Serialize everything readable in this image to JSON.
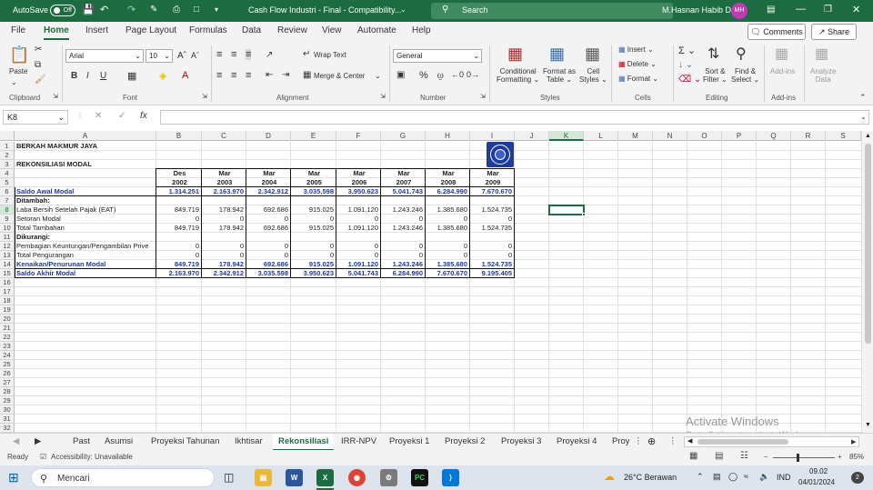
{
  "titlebar": {
    "autosave_label": "AutoSave",
    "autosave_state": "Off",
    "doc_title": "Cash Flow Industri - Final  -  Compatibility...",
    "search_placeholder": "Search",
    "user_name": "M.Hasnan Habib D",
    "user_initials": "MH",
    "brand_color": "#1d6b40"
  },
  "menu": {
    "items": [
      "File",
      "Home",
      "Insert",
      "Page Layout",
      "Formulas",
      "Data",
      "Review",
      "View",
      "Automate",
      "Help"
    ],
    "active": "Home",
    "comments_label": "Comments",
    "share_label": "Share"
  },
  "ribbon": {
    "paste_label": "Paste",
    "font_name": "Arial",
    "font_size": "10",
    "wrap_text": "Wrap Text",
    "merge_center": "Merge & Center",
    "number_format": "General",
    "conditional_formatting": [
      "Conditional",
      "Formatting"
    ],
    "format_as_table": [
      "Format as",
      "Table"
    ],
    "cell_styles": [
      "Cell",
      "Styles"
    ],
    "insert": "Insert",
    "delete": "Delete",
    "format": "Format",
    "sort_filter": [
      "Sort &",
      "Filter"
    ],
    "find_select": [
      "Find &",
      "Select"
    ],
    "addins_btn": "Add-ins",
    "analyze_data": [
      "Analyze",
      "Data"
    ],
    "groups": {
      "clipboard": "Clipboard",
      "font": "Font",
      "alignment": "Alignment",
      "number": "Number",
      "styles": "Styles",
      "cells": "Cells",
      "editing": "Editing",
      "addins": "Add-ins"
    }
  },
  "formula_bar": {
    "name_box": "K8",
    "fx_label": "fx",
    "content": ""
  },
  "grid": {
    "columns": [
      "A",
      "B",
      "C",
      "D",
      "E",
      "F",
      "G",
      "H",
      "I",
      "J",
      "K",
      "L",
      "M",
      "N",
      "O",
      "P",
      "Q",
      "R",
      "S"
    ],
    "rows": [
      "1",
      "2",
      "3",
      "4",
      "5",
      "6",
      "7",
      "8",
      "9",
      "10",
      "11",
      "12",
      "13",
      "14",
      "15",
      "16",
      "17",
      "18",
      "19",
      "20",
      "21",
      "22",
      "23",
      "24",
      "25",
      "26",
      "27",
      "28",
      "29",
      "30",
      "31",
      "32"
    ],
    "selected_cell": "K8"
  },
  "sheet": {
    "company": "BERKAH MAKMUR JAYA",
    "subtitle": "REKONSILIASI MODAL",
    "period_top": [
      "Des",
      "Mar",
      "Mar",
      "Mar",
      "Mar",
      "Mar",
      "Mar",
      "Mar"
    ],
    "period_year": [
      "2002",
      "2003",
      "2004",
      "2005",
      "2006",
      "2007",
      "2008",
      "2009"
    ],
    "rows": [
      {
        "label": "Saldo Awal Modal",
        "style": "blue-bold",
        "values": [
          "1.314.251",
          "2.163.970",
          "2.342.912",
          "3.035.598",
          "3.950.623",
          "5.041.743",
          "6.284.990",
          "7.670.670"
        ]
      },
      {
        "label": "Ditambah:",
        "style": "bold",
        "values": []
      },
      {
        "label": "Laba Bersih Setelah Pajak (EAT)",
        "style": "",
        "values": [
          "849.719",
          "178.942",
          "692.686",
          "915.025",
          "1.091.120",
          "1.243.246",
          "1.385.680",
          "1.524.735"
        ]
      },
      {
        "label": "Setoran Modal",
        "style": "",
        "values": [
          "0",
          "0",
          "0",
          "0",
          "0",
          "0",
          "0",
          "0"
        ]
      },
      {
        "label": "Total Tambahan",
        "style": "",
        "values": [
          "849.719",
          "178.942",
          "692.686",
          "915.025",
          "1.091.120",
          "1.243.246",
          "1.385.680",
          "1.524.735"
        ]
      },
      {
        "label": "Dikurangi:",
        "style": "bold",
        "values": []
      },
      {
        "label": "Pembagian Keuntungan/Pengambilan Prive",
        "style": "",
        "values": [
          "0",
          "0",
          "0",
          "0",
          "0",
          "0",
          "0",
          "0"
        ]
      },
      {
        "label": "Total Pengurangan",
        "style": "",
        "values": [
          "0",
          "0",
          "0",
          "0",
          "0",
          "0",
          "0",
          "0"
        ]
      },
      {
        "label": "Kenaikan/Penurunan Modal",
        "style": "blue-bold",
        "values": [
          "849.719",
          "178.942",
          "692.686",
          "915.025",
          "1.091.120",
          "1.243.246",
          "1.385.680",
          "1.524.735"
        ]
      },
      {
        "label": "Saldo Akhir Modal",
        "style": "blue-bold",
        "values": [
          "2.163.970",
          "2.342.912",
          "3.035.598",
          "3.950.623",
          "5.041.743",
          "6.284.990",
          "7.670.670",
          "9.195.405"
        ]
      }
    ]
  },
  "sheet_tabs": {
    "items": [
      "Past",
      "Asumsi",
      "Proyeksi Tahunan",
      "Ikhtisar",
      "Rekonsiliasi",
      "IRR-NPV",
      "Proyeksi 1",
      "Proyeksi 2",
      "Proyeksi 3",
      "Proyeksi 4",
      "Proy"
    ],
    "active": "Rekonsiliasi"
  },
  "statusbar": {
    "ready": "Ready",
    "accessibility": "Accessibility: Unavailable",
    "zoom": "85%"
  },
  "watermark": {
    "line1": "Activate Windows",
    "line2": "Go to Settings to activate Windows."
  },
  "taskbar": {
    "search_placeholder": "Mencari",
    "weather": "26°C  Berawan",
    "language": "IND",
    "time": "09.02",
    "date": "04/01/2024"
  }
}
